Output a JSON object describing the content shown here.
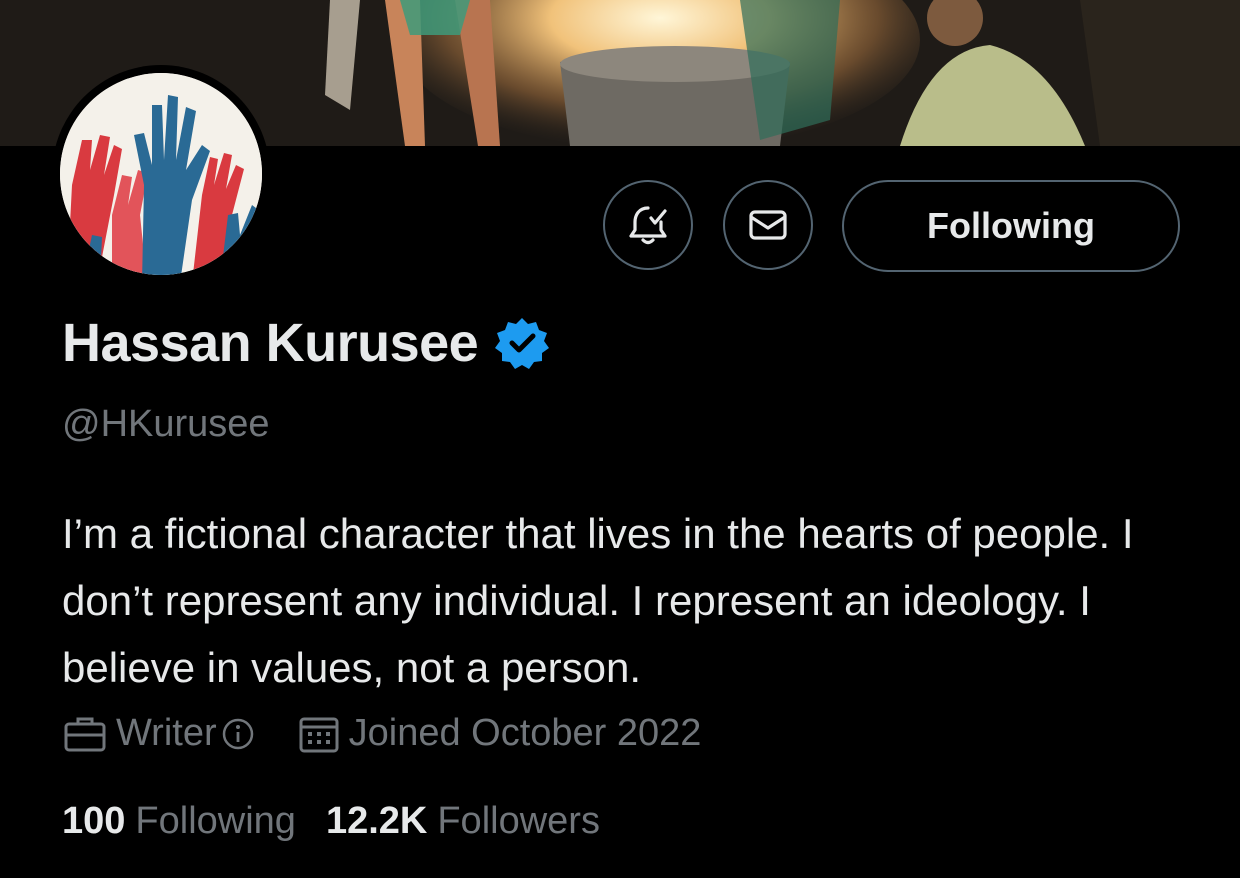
{
  "profile": {
    "display_name": "Hassan Kurusee",
    "handle": "@HKurusee",
    "bio": "I’m a fictional character that lives in the hearts of people. I don’t represent any individual. I represent an ideology. I believe in values, not a person.",
    "profession": "Writer",
    "joined": "Joined October 2022",
    "following_count": "100",
    "following_label": "Following",
    "followers_count": "12.2K",
    "followers_label": "Followers"
  },
  "actions": {
    "follow_button_label": "Following",
    "notify_icon": "bell-check-icon",
    "message_icon": "envelope-icon"
  },
  "icons": {
    "verified": "verified-badge-icon",
    "profession": "briefcase-icon",
    "profession_info": "info-icon",
    "joined": "calendar-icon"
  },
  "colors": {
    "background": "#000000",
    "text": "#e7e9ea",
    "secondary_text": "#71767b",
    "verified_blue": "#1d9bf0",
    "button_border": "#536471"
  }
}
